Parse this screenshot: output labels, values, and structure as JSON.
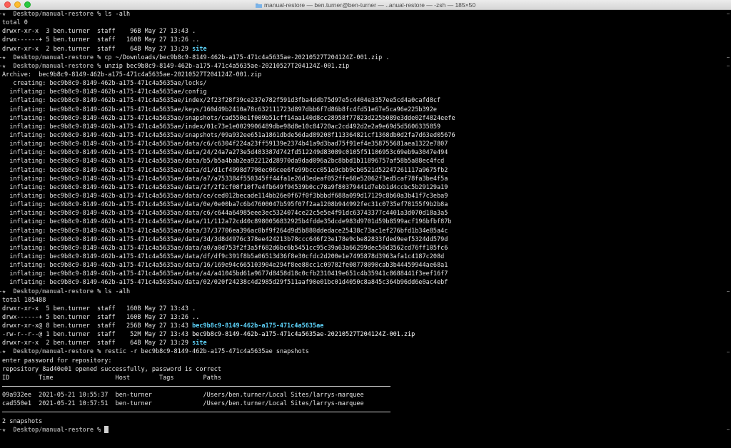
{
  "window": {
    "title": "manual-restore — ben.turner@ben-turner — ..anual-restore — -zsh — 185×50"
  },
  "prompt": {
    "symbol": "★",
    "path": "Desktop/manual-restore",
    "char": "%"
  },
  "terminal": {
    "lines": [
      {
        "kind": "prompt",
        "cmd": "ls -alh"
      },
      {
        "kind": "text",
        "text": "total 0"
      },
      {
        "kind": "ls",
        "perm": "drwxr-xr-x  3 ben.turner  staff    96B May 27 13:43 ",
        "name": ".",
        "cls": "file-white"
      },
      {
        "kind": "ls",
        "perm": "drwx------+ 5 ben.turner  staff   160B May 27 13:26 ",
        "name": "..",
        "cls": "file-white"
      },
      {
        "kind": "ls",
        "perm": "drwxr-xr-x  2 ben.turner  staff    64B May 27 13:29 ",
        "name": "site",
        "cls": "dir-cyan-bold"
      },
      {
        "kind": "prompt",
        "cmd": "cp ~/Downloads/bec9b8c9-8149-462b-a175-471c4a5635ae-20210527T204124Z-001.zip ."
      },
      {
        "kind": "prompt",
        "cmd": "unzip bec9b8c9-8149-462b-a175-471c4a5635ae-20210527T204124Z-001.zip"
      },
      {
        "kind": "text",
        "text": "Archive:  bec9b8c9-8149-462b-a175-471c4a5635ae-20210527T204124Z-001.zip"
      },
      {
        "kind": "text",
        "text": "   creating: bec9b8c9-8149-462b-a175-471c4a5635ae/locks/"
      },
      {
        "kind": "text",
        "text": "  inflating: bec9b8c9-8149-462b-a175-471c4a5635ae/config"
      },
      {
        "kind": "text",
        "text": "  inflating: bec9b8c9-8149-462b-a175-471c4a5635ae/index/2f23f28f39ce237e782f591d3fba4ddb75d97e5c4404e3357ee5cd4a0cafd8cf"
      },
      {
        "kind": "text",
        "text": "  inflating: bec9b8c9-8149-462b-a175-471c4a5635ae/keys/160d49b2410a78c632111723d897dbb6f7d86b8fc4fd51e67e5ca96e225b392e"
      },
      {
        "kind": "text",
        "text": "  inflating: bec9b8c9-8149-462b-a175-471c4a5635ae/snapshots/cad550e1f009b51cff14aa140d8cc28958f77823d225b089e3dde02f4824eefe"
      },
      {
        "kind": "text",
        "text": "  inflating: bec9b8c9-8149-462b-a175-471c4a5635ae/index/01c73e1e0029906489dbe98d8e10c84720ac2cd492d2e2a9e69d5d5606335859"
      },
      {
        "kind": "text",
        "text": "  inflating: bec9b8c9-8149-462b-a175-471c4a5635ae/snapshots/09a932ee651a1861dbde56dad89208f113364821cf1368db0d2fa7d63ed05676"
      },
      {
        "kind": "text",
        "text": "  inflating: bec9b8c9-8149-462b-a175-471c4a5635ae/data/c6/c6304f224a23ff59139e2374b41a9d3bad75f91ef4e358755681aea1322e7807"
      },
      {
        "kind": "text",
        "text": "  inflating: bec9b8c9-8149-462b-a175-471c4a5635ae/data/24/24a7a273e5d483387d742fd512249d83089c0105f51106953c69eb9a3047e494"
      },
      {
        "kind": "text",
        "text": "  inflating: bec9b8c9-8149-462b-a175-471c4a5635ae/data/b5/b5a4bab2ea92212d28970da9dad096a2bc8bbd1b11896757af58b5a88ec4fcd"
      },
      {
        "kind": "text",
        "text": "  inflating: bec9b8c9-8149-462b-a175-471c4a5635ae/data/d1/d1cf4998d7798ec06cee6fe99bccc051e9cbb9cb0521d52247261117a9675fb2"
      },
      {
        "kind": "text",
        "text": "  inflating: bec9b8c9-8149-462b-a175-471c4a5635ae/data/a7/a753384f550345ff44fa1e26d3edeaf052ffe68e52062f3ed5caf78fa3be4f5a"
      },
      {
        "kind": "text",
        "text": "  inflating: bec9b8c9-8149-462b-a175-471c4a5635ae/data/2f/2f2cf08f10f7e4fb649f94539b0cc78a9f80379441d7ebb1d4ccbc5b29129a19"
      },
      {
        "kind": "text",
        "text": "  inflating: bec9b8c9-8149-462b-a175-471c4a5635ae/data/ce/ced012becade114bb26e0f67f0f3bbbdf688a099d17129c8b60a3b41f7c3eba9"
      },
      {
        "kind": "text",
        "text": "  inflating: bec9b8c9-8149-462b-a175-471c4a5635ae/data/0e/0e00ba7c6b47600047b595f07f2aa1208b944992fec31c0735ef78155f9b2b8a"
      },
      {
        "kind": "text",
        "text": "  inflating: bec9b8c9-8149-462b-a175-471c4a5635ae/data/c6/c644a64985eee3ec5324074ce22c5e5e4f91dc63743377c4401a3d070d18a3a5"
      },
      {
        "kind": "text",
        "text": "  inflating: bec9b8c9-8149-462b-a175-471c4a5635ae/data/11/112a72cd40c8980056832925b4fdde35dcde983d9701d59b8599acf196bfbf87b"
      },
      {
        "kind": "text",
        "text": "  inflating: bec9b8c9-8149-462b-a175-471c4a5635ae/data/37/37706ea396ac0bf9f264d9d5b880ddedace25438c73ac1ef276bfd1b34e85a4c"
      },
      {
        "kind": "text",
        "text": "  inflating: bec9b8c9-8149-462b-a175-471c4a5635ae/data/3d/3d8d4976c378ee424213b78ccc646f23e178e9cbe82833fded9eef5324dd579d"
      },
      {
        "kind": "text",
        "text": "  inflating: bec9b8c9-8149-462b-a175-471c4a5635ae/data/a0/a0d753f2f3a5f682d6bc6b5451cc95c39a63a66299dec50d3562cd76ff105fc6"
      },
      {
        "kind": "text",
        "text": "  inflating: bec9b8c9-8149-462b-a175-471c4a5635ae/data/df/df9c391f8b5a06513d36f8e30cfdc2d200e1e7495878d3963afa1c4187c208d"
      },
      {
        "kind": "text",
        "text": "  inflating: bec9b8c9-8149-462b-a175-471c4a5635ae/data/16/169e94c665103904e294f8ee88cc1c09782fe08778090cab3b44459944ae68a1"
      },
      {
        "kind": "text",
        "text": "  inflating: bec9b8c9-8149-462b-a175-471c4a5635ae/data/a4/a41045bd61a9677d8458d18c0cfb2310419e651c4b35941c8688441f3eef16f7"
      },
      {
        "kind": "text",
        "text": "  inflating: bec9b8c9-8149-462b-a175-471c4a5635ae/data/02/020f24238c4d2985d29f511aaf90e01bc01d4050c8a845c364b96dd6e0ac4ebf"
      },
      {
        "kind": "prompt",
        "cmd": "ls -alh"
      },
      {
        "kind": "text",
        "text": "total 105488"
      },
      {
        "kind": "ls",
        "perm": "drwxr-xr-x  5 ben.turner  staff   160B May 27 13:43 ",
        "name": ".",
        "cls": "file-white"
      },
      {
        "kind": "ls",
        "perm": "drwx------+ 5 ben.turner  staff   160B May 27 13:26 ",
        "name": "..",
        "cls": "file-white"
      },
      {
        "kind": "ls",
        "perm": "drwxr-xr-x@ 8 ben.turner  staff   256B May 27 13:43 ",
        "name": "bec9b8c9-8149-462b-a175-471c4a5635ae",
        "cls": "dir-cyan-bold"
      },
      {
        "kind": "ls",
        "perm": "-rw-r--r--@ 1 ben.turner  staff    52M May 27 13:43 ",
        "name": "bec9b8c9-8149-462b-a175-471c4a5635ae-20210527T204124Z-001.zip",
        "cls": "file-white"
      },
      {
        "kind": "ls",
        "perm": "drwxr-xr-x  2 ben.turner  staff    64B May 27 13:29 ",
        "name": "site",
        "cls": "dir-cyan-bold"
      },
      {
        "kind": "prompt",
        "cmd": "restic -r bec9b8c9-8149-462b-a175-471c4a5635ae snapshots"
      },
      {
        "kind": "text",
        "text": "enter password for repository:"
      },
      {
        "kind": "text",
        "text": "repository 8ad40e01 opened successfully, password is correct"
      },
      {
        "kind": "text",
        "text": "ID        Time                 Host        Tags        Paths"
      },
      {
        "kind": "rule"
      },
      {
        "kind": "text",
        "text": "09a932ee  2021-05-21 10:55:37  ben-turner              /Users/ben.turner/Local Sites/larrys-marquee"
      },
      {
        "kind": "text",
        "text": "cad550e1  2021-05-21 10:57:51  ben-turner              /Users/ben.turner/Local Sites/larrys-marquee"
      },
      {
        "kind": "rule"
      },
      {
        "kind": "text",
        "text": "2 snapshots"
      },
      {
        "kind": "prompt",
        "cmd": "",
        "cursor": true
      }
    ]
  }
}
